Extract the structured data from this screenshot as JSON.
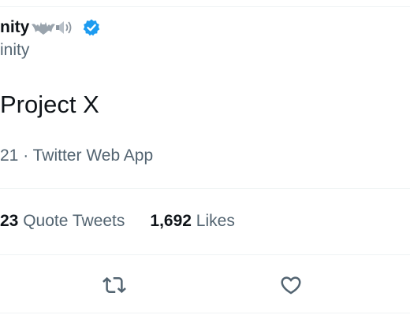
{
  "author": {
    "display_name": "nity",
    "handle": "inity",
    "name_emoji_icons": [
      "bat-emoji-icon",
      "speaker-emoji-icon"
    ],
    "verified": true
  },
  "tweet": {
    "text": "Project X",
    "meta": "21 · Twitter Web App"
  },
  "stats": {
    "quote_count": "23",
    "quote_label": "Quote Tweets",
    "likes_count": "1,692",
    "likes_label": "Likes"
  },
  "actions": [
    "retweet-icon",
    "like-icon"
  ],
  "colors": {
    "verified": "#1d9bf0",
    "secondary_text": "#536471",
    "primary_text": "#0f1419",
    "divider": "#eff3f4"
  }
}
